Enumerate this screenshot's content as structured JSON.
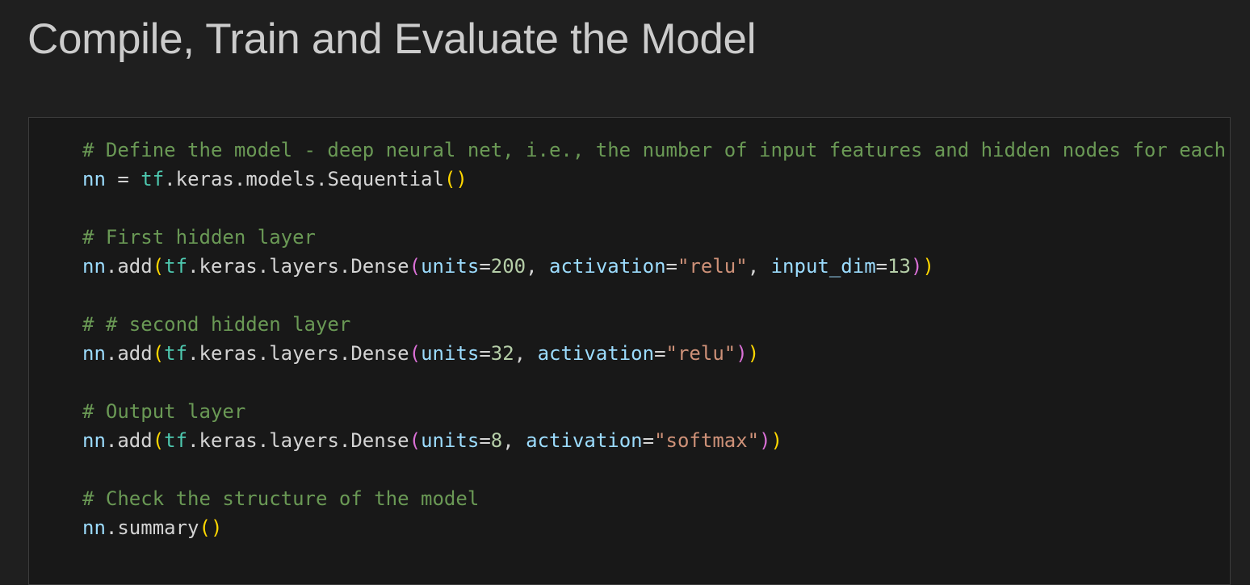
{
  "page": {
    "heading": "Compile, Train and Evaluate the Model"
  },
  "colors": {
    "background": "#1f1f1f",
    "cell_background": "#181818",
    "heading": "#cccccc",
    "comment": "#6a9955",
    "variable": "#9cdcfe",
    "module": "#4ec9b0",
    "number": "#b5cea8",
    "string": "#ce9178",
    "bracket_level_1": "#ffd700",
    "bracket_level_2": "#da70d6"
  },
  "code_cell": {
    "lines": [
      [
        {
          "t": "comment",
          "v": "# Define the model - deep neural net, i.e., the number of input features and hidden nodes for each layer."
        }
      ],
      [
        {
          "t": "var",
          "v": "nn"
        },
        {
          "t": "plain",
          "v": " = "
        },
        {
          "t": "mod",
          "v": "tf"
        },
        {
          "t": "plain",
          "v": ".keras.models.Sequential"
        },
        {
          "t": "b1",
          "v": "()"
        }
      ],
      [],
      [
        {
          "t": "comment",
          "v": "# First hidden layer"
        }
      ],
      [
        {
          "t": "var",
          "v": "nn"
        },
        {
          "t": "plain",
          "v": ".add"
        },
        {
          "t": "b1",
          "v": "("
        },
        {
          "t": "mod",
          "v": "tf"
        },
        {
          "t": "plain",
          "v": ".keras.layers.Dense"
        },
        {
          "t": "b2",
          "v": "("
        },
        {
          "t": "param",
          "v": "units"
        },
        {
          "t": "plain",
          "v": "="
        },
        {
          "t": "num",
          "v": "200"
        },
        {
          "t": "plain",
          "v": ", "
        },
        {
          "t": "param",
          "v": "activation"
        },
        {
          "t": "plain",
          "v": "="
        },
        {
          "t": "str",
          "v": "\"relu\""
        },
        {
          "t": "plain",
          "v": ", "
        },
        {
          "t": "param",
          "v": "input_dim"
        },
        {
          "t": "plain",
          "v": "="
        },
        {
          "t": "num",
          "v": "13"
        },
        {
          "t": "b2",
          "v": ")"
        },
        {
          "t": "b1",
          "v": ")"
        }
      ],
      [],
      [
        {
          "t": "comment",
          "v": "# # second hidden layer"
        }
      ],
      [
        {
          "t": "var",
          "v": "nn"
        },
        {
          "t": "plain",
          "v": ".add"
        },
        {
          "t": "b1",
          "v": "("
        },
        {
          "t": "mod",
          "v": "tf"
        },
        {
          "t": "plain",
          "v": ".keras.layers.Dense"
        },
        {
          "t": "b2",
          "v": "("
        },
        {
          "t": "param",
          "v": "units"
        },
        {
          "t": "plain",
          "v": "="
        },
        {
          "t": "num",
          "v": "32"
        },
        {
          "t": "plain",
          "v": ", "
        },
        {
          "t": "param",
          "v": "activation"
        },
        {
          "t": "plain",
          "v": "="
        },
        {
          "t": "str",
          "v": "\"relu\""
        },
        {
          "t": "b2",
          "v": ")"
        },
        {
          "t": "b1",
          "v": ")"
        }
      ],
      [],
      [
        {
          "t": "comment",
          "v": "# Output layer"
        }
      ],
      [
        {
          "t": "var",
          "v": "nn"
        },
        {
          "t": "plain",
          "v": ".add"
        },
        {
          "t": "b1",
          "v": "("
        },
        {
          "t": "mod",
          "v": "tf"
        },
        {
          "t": "plain",
          "v": ".keras.layers.Dense"
        },
        {
          "t": "b2",
          "v": "("
        },
        {
          "t": "param",
          "v": "units"
        },
        {
          "t": "plain",
          "v": "="
        },
        {
          "t": "num",
          "v": "8"
        },
        {
          "t": "plain",
          "v": ", "
        },
        {
          "t": "param",
          "v": "activation"
        },
        {
          "t": "plain",
          "v": "="
        },
        {
          "t": "str",
          "v": "\"softmax\""
        },
        {
          "t": "b2",
          "v": ")"
        },
        {
          "t": "b1",
          "v": ")"
        }
      ],
      [],
      [
        {
          "t": "comment",
          "v": "# Check the structure of the model"
        }
      ],
      [
        {
          "t": "var",
          "v": "nn"
        },
        {
          "t": "plain",
          "v": ".summary"
        },
        {
          "t": "b1",
          "v": "()"
        }
      ]
    ]
  }
}
